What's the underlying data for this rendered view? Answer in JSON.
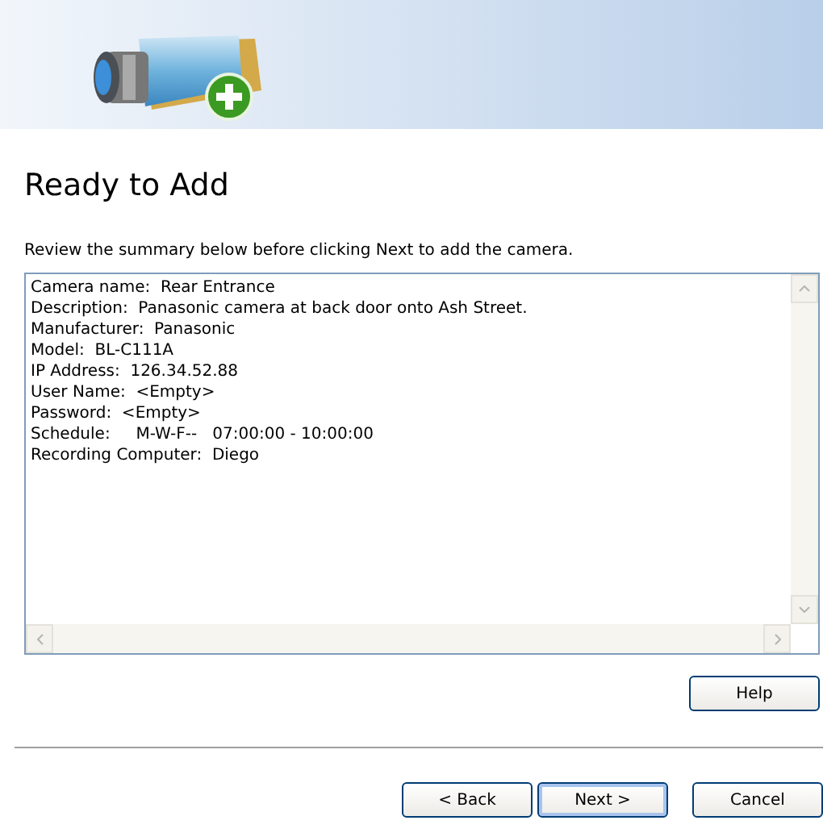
{
  "header": {
    "title": "Ready to Add"
  },
  "instruction": "Review the summary below before clicking Next to add the camera.",
  "summary": {
    "lines": [
      "Camera name:  Rear Entrance",
      "Description:  Panasonic camera at back door onto Ash Street.",
      "Manufacturer:  Panasonic",
      "Model:  BL-C111A",
      "IP Address:  126.34.52.88",
      "User Name:  <Empty>",
      "Password:  <Empty>",
      "Schedule:     M-W-F--   07:00:00 - 10:00:00",
      "Recording Computer:  Diego"
    ]
  },
  "help_button": "Help",
  "buttons": [
    {
      "label": "< Back",
      "default": false
    },
    {
      "label": "Next >",
      "default": true
    },
    {
      "label": "Cancel",
      "default": false
    }
  ]
}
